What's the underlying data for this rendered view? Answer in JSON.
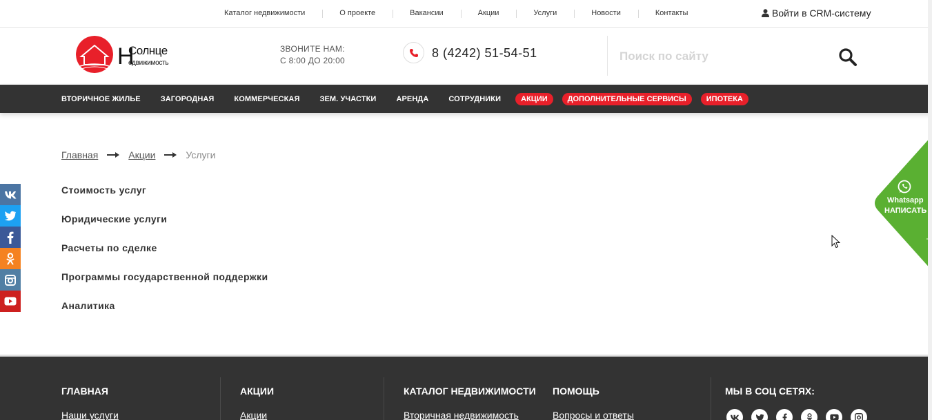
{
  "topbar": {
    "links": [
      "Каталог недвижимости",
      "О проекте",
      "Вакансии",
      "Акции",
      "Услуги",
      "Новости",
      "Контакты"
    ],
    "crm_label": "Войти в CRM-систему"
  },
  "header": {
    "logo_line1": "Солнце",
    "logo_line2": "едвижимость",
    "logo_letter": "Н",
    "callus_line1": "ЗВОНИТЕ НАМ:",
    "callus_line2": "С 8:00 ДО 20:00",
    "phone": "8 (4242) 51-54-51",
    "search_placeholder": "Поиск по сайту"
  },
  "nav": {
    "items": [
      "ВТОРИЧНОЕ ЖИЛЬЕ",
      "ЗАГОРОДНАЯ",
      "КОММЕРЧЕСКАЯ",
      "ЗЕМ. УЧАСТКИ",
      "АРЕНДА",
      "СОТРУДНИКИ"
    ],
    "pills": [
      "АКЦИИ",
      "ДОПОЛНИТЕЛЬНЫЕ СЕРВИСЫ",
      "ИПОТЕКА"
    ]
  },
  "breadcrumb": {
    "home": "Главная",
    "promo": "Акции",
    "current": "Услуги"
  },
  "services": [
    "Стоимость услуг",
    "Юридические услуги",
    "Расчеты по сделке",
    "Программы государственной поддержки",
    "Аналитика"
  ],
  "social_side": [
    {
      "icon": "vk-icon",
      "color": "#4c75a3"
    },
    {
      "icon": "twitter-icon",
      "color": "#1da1f2"
    },
    {
      "icon": "facebook-icon",
      "color": "#3b5998"
    },
    {
      "icon": "odnoklassniki-icon",
      "color": "#f58220"
    },
    {
      "icon": "instagram-icon",
      "color": "#517fa4"
    },
    {
      "icon": "youtube-icon",
      "color": "#cd201f"
    }
  ],
  "whatsapp": {
    "label1": "Whatsapp",
    "label2": "НАПИСАТЬ",
    "color": "#5ab032"
  },
  "footer": {
    "col1_title": "ГЛАВНАЯ",
    "col1_link": "Наши услуги",
    "col2_title": "АКЦИИ",
    "col2_link": "Акции",
    "col3_title": "КАТАЛОГ НЕДВИЖИМОСТИ",
    "col3_link": "Вторичная недвижимость",
    "col4_title": "ПОМОЩЬ",
    "col4_link": "Вопросы и ответы",
    "col5_title": "МЫ В СОЦ СЕТЯХ:"
  },
  "colors": {
    "accent_red": "#e8202a",
    "nav_bg": "#333333",
    "footer_bg": "#333333"
  }
}
